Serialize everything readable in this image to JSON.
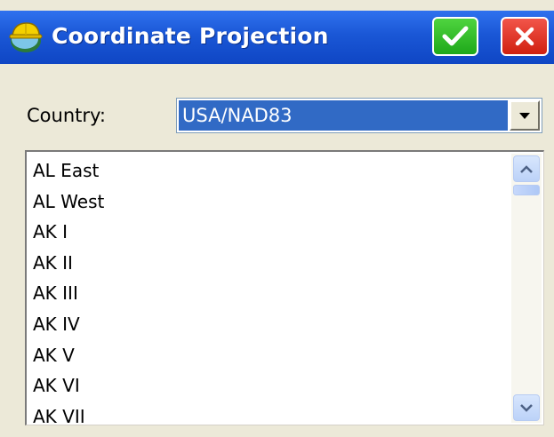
{
  "window": {
    "title": "Coordinate Projection",
    "icon": "app-hardhat-icon",
    "ok_icon": "checkmark-icon",
    "close_icon": "x-icon"
  },
  "form": {
    "country_label": "Country:",
    "country_value": "USA/NAD83"
  },
  "zones": [
    "AL East",
    "AL West",
    "AK I",
    "AK II",
    "AK III",
    "AK IV",
    "AK V",
    "AK VI",
    "AK VII"
  ],
  "colors": {
    "title_bar": "#1a57d6",
    "ok_button": "#1ea81a",
    "close_button": "#d0200f",
    "selection": "#316ac5"
  }
}
